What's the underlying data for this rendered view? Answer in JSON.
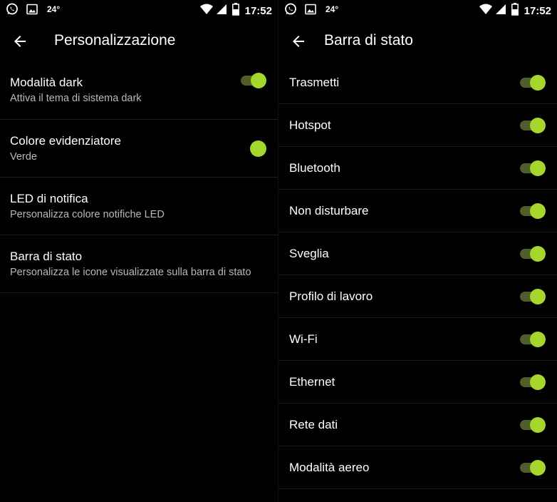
{
  "colors": {
    "accent": "#a4d62b",
    "track": "#4f5f27",
    "background": "#000000",
    "secondary_text": "#b9b9b9"
  },
  "status_bar": {
    "temperature": "24°",
    "time": "17:52",
    "left_icons": [
      "whatsapp-icon",
      "gallery-icon"
    ],
    "right_icons": [
      "wifi-icon",
      "signal-icon",
      "battery-icon"
    ]
  },
  "left_screen": {
    "title": "Personalizzazione",
    "items": [
      {
        "title": "Modalità dark",
        "subtitle": "Attiva il tema di sistema dark",
        "control": "switch",
        "on": true
      },
      {
        "title": "Colore evidenziatore",
        "subtitle": "Verde",
        "control": "color"
      },
      {
        "title": "LED di notifica",
        "subtitle": "Personalizza colore notifiche LED"
      },
      {
        "title": "Barra di stato",
        "subtitle": "Personalizza le icone visualizzate sulla barra di stato"
      }
    ]
  },
  "right_screen": {
    "title": "Barra di stato",
    "items": [
      {
        "title": "Trasmetti",
        "on": true
      },
      {
        "title": "Hotspot",
        "on": true
      },
      {
        "title": "Bluetooth",
        "on": true
      },
      {
        "title": "Non disturbare",
        "on": true
      },
      {
        "title": "Sveglia",
        "on": true
      },
      {
        "title": "Profilo di lavoro",
        "on": true
      },
      {
        "title": "Wi-Fi",
        "on": true
      },
      {
        "title": "Ethernet",
        "on": true
      },
      {
        "title": "Rete dati",
        "on": true
      },
      {
        "title": "Modalità aereo",
        "on": true
      }
    ]
  }
}
